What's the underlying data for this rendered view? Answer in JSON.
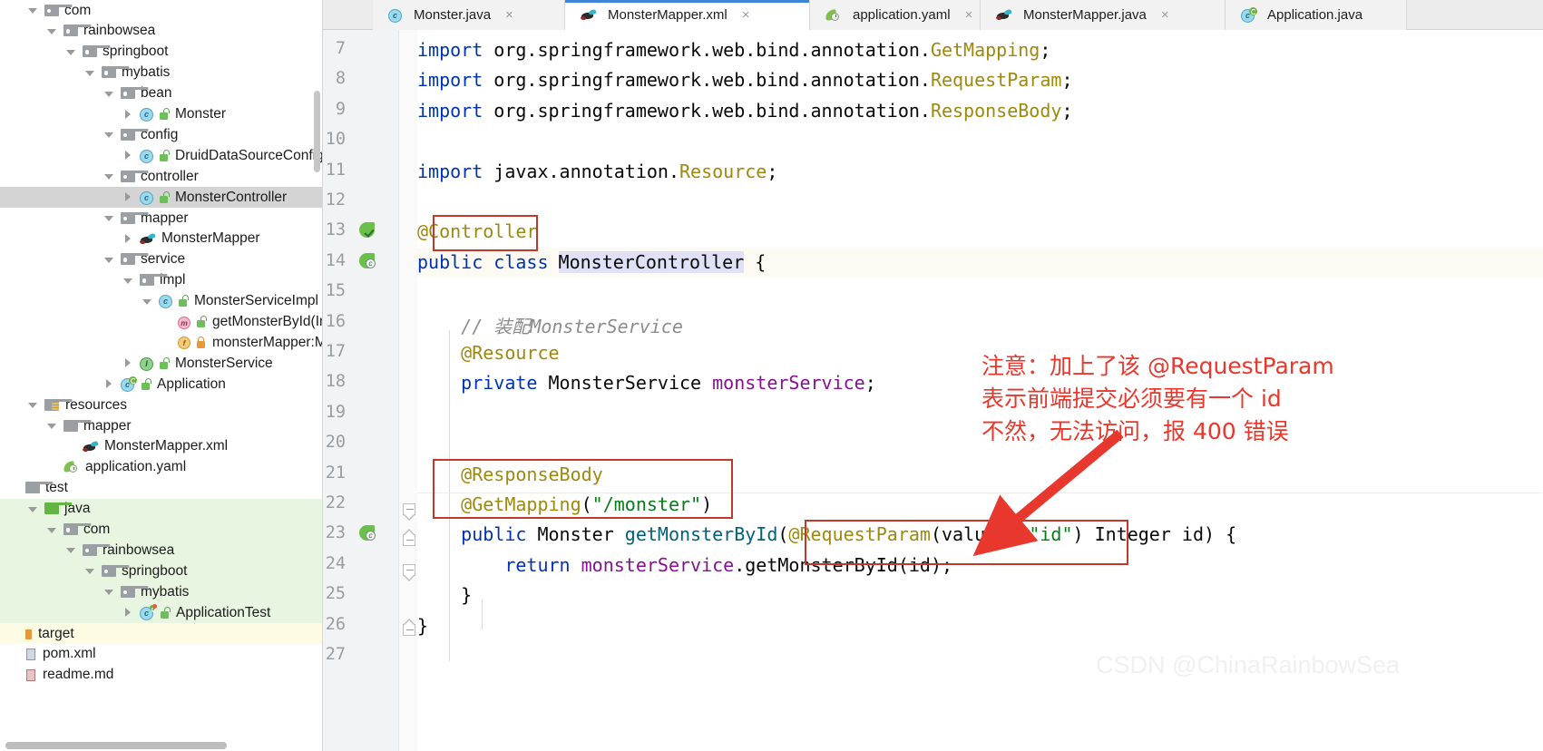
{
  "project_tree": {
    "items": [
      {
        "label": "com",
        "indent": 1,
        "arrow": "down",
        "icon": "package-folder-icon",
        "state": "normal"
      },
      {
        "label": "rainbowsea",
        "indent": 2,
        "arrow": "down",
        "icon": "package-folder-icon",
        "state": "normal"
      },
      {
        "label": "springboot",
        "indent": 3,
        "arrow": "down",
        "icon": "package-folder-icon",
        "state": "normal"
      },
      {
        "label": "mybatis",
        "indent": 4,
        "arrow": "down",
        "icon": "package-folder-icon",
        "state": "normal"
      },
      {
        "label": "bean",
        "indent": 5,
        "arrow": "down",
        "icon": "package-folder-icon",
        "state": "normal"
      },
      {
        "label": "Monster",
        "indent": 6,
        "arrow": "right",
        "icon": "java-class-icon",
        "vis": "public",
        "state": "normal"
      },
      {
        "label": "config",
        "indent": 5,
        "arrow": "down",
        "icon": "package-folder-icon",
        "state": "normal"
      },
      {
        "label": "DruidDataSourceConfig",
        "indent": 6,
        "arrow": "right",
        "icon": "java-class-icon",
        "vis": "public",
        "state": "normal"
      },
      {
        "label": "controller",
        "indent": 5,
        "arrow": "down",
        "icon": "package-folder-icon",
        "state": "normal"
      },
      {
        "label": "MonsterController",
        "indent": 6,
        "arrow": "right",
        "icon": "java-class-icon",
        "vis": "public",
        "state": "selected"
      },
      {
        "label": "mapper",
        "indent": 5,
        "arrow": "down",
        "icon": "package-folder-icon",
        "state": "normal"
      },
      {
        "label": "MonsterMapper",
        "indent": 6,
        "arrow": "right",
        "icon": "mybatis-mapper-icon",
        "state": "normal"
      },
      {
        "label": "service",
        "indent": 5,
        "arrow": "down",
        "icon": "package-folder-icon",
        "state": "normal"
      },
      {
        "label": "impl",
        "indent": 6,
        "arrow": "down",
        "icon": "package-folder-icon",
        "state": "normal"
      },
      {
        "label": "MonsterServiceImpl",
        "indent": 7,
        "arrow": "down",
        "icon": "java-class-icon",
        "vis": "public",
        "state": "normal"
      },
      {
        "label": "getMonsterById(In",
        "indent": 8,
        "arrow": "none",
        "icon": "method-icon",
        "vis": "public",
        "state": "normal"
      },
      {
        "label": "monsterMapper:M",
        "indent": 8,
        "arrow": "none",
        "icon": "field-icon",
        "vis": "private",
        "state": "normal"
      },
      {
        "label": "MonsterService",
        "indent": 6,
        "arrow": "right",
        "icon": "java-interface-icon",
        "vis": "public",
        "state": "normal"
      },
      {
        "label": "Application",
        "indent": 5,
        "arrow": "right",
        "icon": "spring-boot-app-icon",
        "vis": "public",
        "state": "normal"
      },
      {
        "label": "resources",
        "indent": 1,
        "arrow": "down",
        "icon": "resources-folder-icon",
        "state": "normal"
      },
      {
        "label": "mapper",
        "indent": 2,
        "arrow": "down",
        "icon": "folder-icon",
        "state": "normal"
      },
      {
        "label": "MonsterMapper.xml",
        "indent": 3,
        "arrow": "none",
        "icon": "mybatis-mapper-icon",
        "state": "normal"
      },
      {
        "label": "application.yaml",
        "indent": 2,
        "arrow": "none",
        "icon": "yaml-icon",
        "state": "normal"
      },
      {
        "label": "test",
        "indent": 0,
        "arrow": "none",
        "icon": "folder-icon",
        "state": "normal"
      },
      {
        "label": "java",
        "indent": 1,
        "arrow": "down",
        "icon": "green-folder-icon",
        "state": "green"
      },
      {
        "label": "com",
        "indent": 2,
        "arrow": "down",
        "icon": "package-folder-icon",
        "state": "green"
      },
      {
        "label": "rainbowsea",
        "indent": 3,
        "arrow": "down",
        "icon": "package-folder-icon",
        "state": "green"
      },
      {
        "label": "springboot",
        "indent": 4,
        "arrow": "down",
        "icon": "package-folder-icon",
        "state": "green"
      },
      {
        "label": "mybatis",
        "indent": 5,
        "arrow": "down",
        "icon": "package-folder-icon",
        "state": "green"
      },
      {
        "label": "ApplicationTest",
        "indent": 6,
        "arrow": "right",
        "icon": "test-class-icon",
        "vis": "public",
        "state": "green"
      },
      {
        "label": "target",
        "indent": 0,
        "arrow": "none",
        "icon": "target-folder-icon",
        "state": "yellow"
      },
      {
        "label": "pom.xml",
        "indent": 0,
        "arrow": "none",
        "icon": "xml-file-icon",
        "state": "normal"
      },
      {
        "label": "readme.md",
        "indent": 0,
        "arrow": "none",
        "icon": "markdown-file-icon",
        "state": "normal"
      }
    ]
  },
  "tabs": [
    {
      "label": "Monster.java",
      "icon": "java-class-icon",
      "active": false,
      "close": "×"
    },
    {
      "label": "MonsterMapper.xml",
      "icon": "mybatis-mapper-icon",
      "active": true,
      "close": "×"
    },
    {
      "label": "application.yaml",
      "icon": "yaml-icon",
      "active": false,
      "close": "×"
    },
    {
      "label": "MonsterMapper.java",
      "icon": "mybatis-mapper-icon",
      "active": false,
      "close": "×"
    },
    {
      "label": "Application.java",
      "icon": "spring-boot-app-icon",
      "active": false,
      "close": ""
    }
  ],
  "editor": {
    "first_visible_line": 7,
    "lines": [
      {
        "num": 7,
        "tokens": [
          {
            "t": "import ",
            "c": "kw"
          },
          {
            "t": "org.springframework.web.bind.annotation.",
            "c": "pln"
          },
          {
            "t": "GetMapping",
            "c": "anno"
          },
          {
            "t": ";",
            "c": "pln"
          }
        ]
      },
      {
        "num": 8,
        "tokens": [
          {
            "t": "import ",
            "c": "kw"
          },
          {
            "t": "org.springframework.web.bind.annotation.",
            "c": "pln"
          },
          {
            "t": "RequestParam",
            "c": "anno"
          },
          {
            "t": ";",
            "c": "pln"
          }
        ]
      },
      {
        "num": 9,
        "tokens": [
          {
            "t": "import ",
            "c": "kw"
          },
          {
            "t": "org.springframework.web.bind.annotation.",
            "c": "pln"
          },
          {
            "t": "ResponseBody",
            "c": "anno"
          },
          {
            "t": ";",
            "c": "pln"
          }
        ]
      },
      {
        "num": 10,
        "tokens": []
      },
      {
        "num": 11,
        "tokens": [
          {
            "t": "import ",
            "c": "kw"
          },
          {
            "t": "javax.annotation.",
            "c": "pln"
          },
          {
            "t": "Resource",
            "c": "anno"
          },
          {
            "t": ";",
            "c": "pln"
          }
        ]
      },
      {
        "num": 12,
        "tokens": []
      },
      {
        "num": 13,
        "tokens": [
          {
            "t": "@Controller",
            "c": "anno"
          }
        ]
      },
      {
        "num": 14,
        "tokens": [
          {
            "t": "public ",
            "c": "kw"
          },
          {
            "t": "class ",
            "c": "kw"
          },
          {
            "t": "MonsterController",
            "c": "cls"
          },
          {
            "t": " {",
            "c": "pln"
          }
        ]
      },
      {
        "num": 15,
        "tokens": []
      },
      {
        "num": 16,
        "tokens": [
          {
            "t": "    // 装配MonsterService",
            "c": "cmt"
          }
        ]
      },
      {
        "num": 17,
        "tokens": [
          {
            "t": "    @Resource",
            "c": "anno"
          }
        ]
      },
      {
        "num": 18,
        "tokens": [
          {
            "t": "    private ",
            "c": "kw"
          },
          {
            "t": "MonsterService ",
            "c": "pln"
          },
          {
            "t": "monsterService",
            "c": "fld"
          },
          {
            "t": ";",
            "c": "pln"
          }
        ]
      },
      {
        "num": 19,
        "tokens": []
      },
      {
        "num": 20,
        "tokens": []
      },
      {
        "num": 21,
        "tokens": [
          {
            "t": "    @ResponseBody",
            "c": "anno"
          }
        ]
      },
      {
        "num": 22,
        "tokens": [
          {
            "t": "    @GetMapping",
            "c": "anno"
          },
          {
            "t": "(",
            "c": "pln"
          },
          {
            "t": "\"/monster\"",
            "c": "str"
          },
          {
            "t": ")",
            "c": "pln"
          }
        ]
      },
      {
        "num": 23,
        "tokens": [
          {
            "t": "    public ",
            "c": "kw"
          },
          {
            "t": "Monster ",
            "c": "pln"
          },
          {
            "t": "getMonsterById",
            "c": "mth"
          },
          {
            "t": "(",
            "c": "pln"
          },
          {
            "t": "@RequestParam",
            "c": "anno"
          },
          {
            "t": "(value = ",
            "c": "pln"
          },
          {
            "t": "\"id\"",
            "c": "str"
          },
          {
            "t": ") Integer id) {",
            "c": "pln"
          }
        ]
      },
      {
        "num": 24,
        "tokens": [
          {
            "t": "        return ",
            "c": "kw"
          },
          {
            "t": "monsterService",
            "c": "fld"
          },
          {
            "t": ".",
            "c": "pln"
          },
          {
            "t": "getMonsterById",
            "c": "pln"
          },
          {
            "t": "(id);",
            "c": "pln"
          }
        ]
      },
      {
        "num": 25,
        "tokens": [
          {
            "t": "    }",
            "c": "pln"
          }
        ]
      },
      {
        "num": 26,
        "tokens": [
          {
            "t": "}",
            "c": "pln"
          }
        ]
      },
      {
        "num": 27,
        "tokens": []
      }
    ],
    "caret_line": 14,
    "selected_text": "MonsterController"
  },
  "annotation": {
    "note_lines": [
      "注意：加上了该 @RequestParam",
      "表示前端提交必须要有一个 id",
      "不然，无法访问，报 400 错误"
    ],
    "note_color": "#e8372c",
    "box_color": "#c0392b",
    "arrow_color": "#e8372c",
    "boxes": [
      {
        "name": "controller-annotation-box"
      },
      {
        "name": "mapping-annotations-box"
      },
      {
        "name": "request-param-box"
      }
    ]
  },
  "watermark": {
    "text": "CSDN @ChinaRainbowSea",
    "color": "#f0f0f0"
  }
}
